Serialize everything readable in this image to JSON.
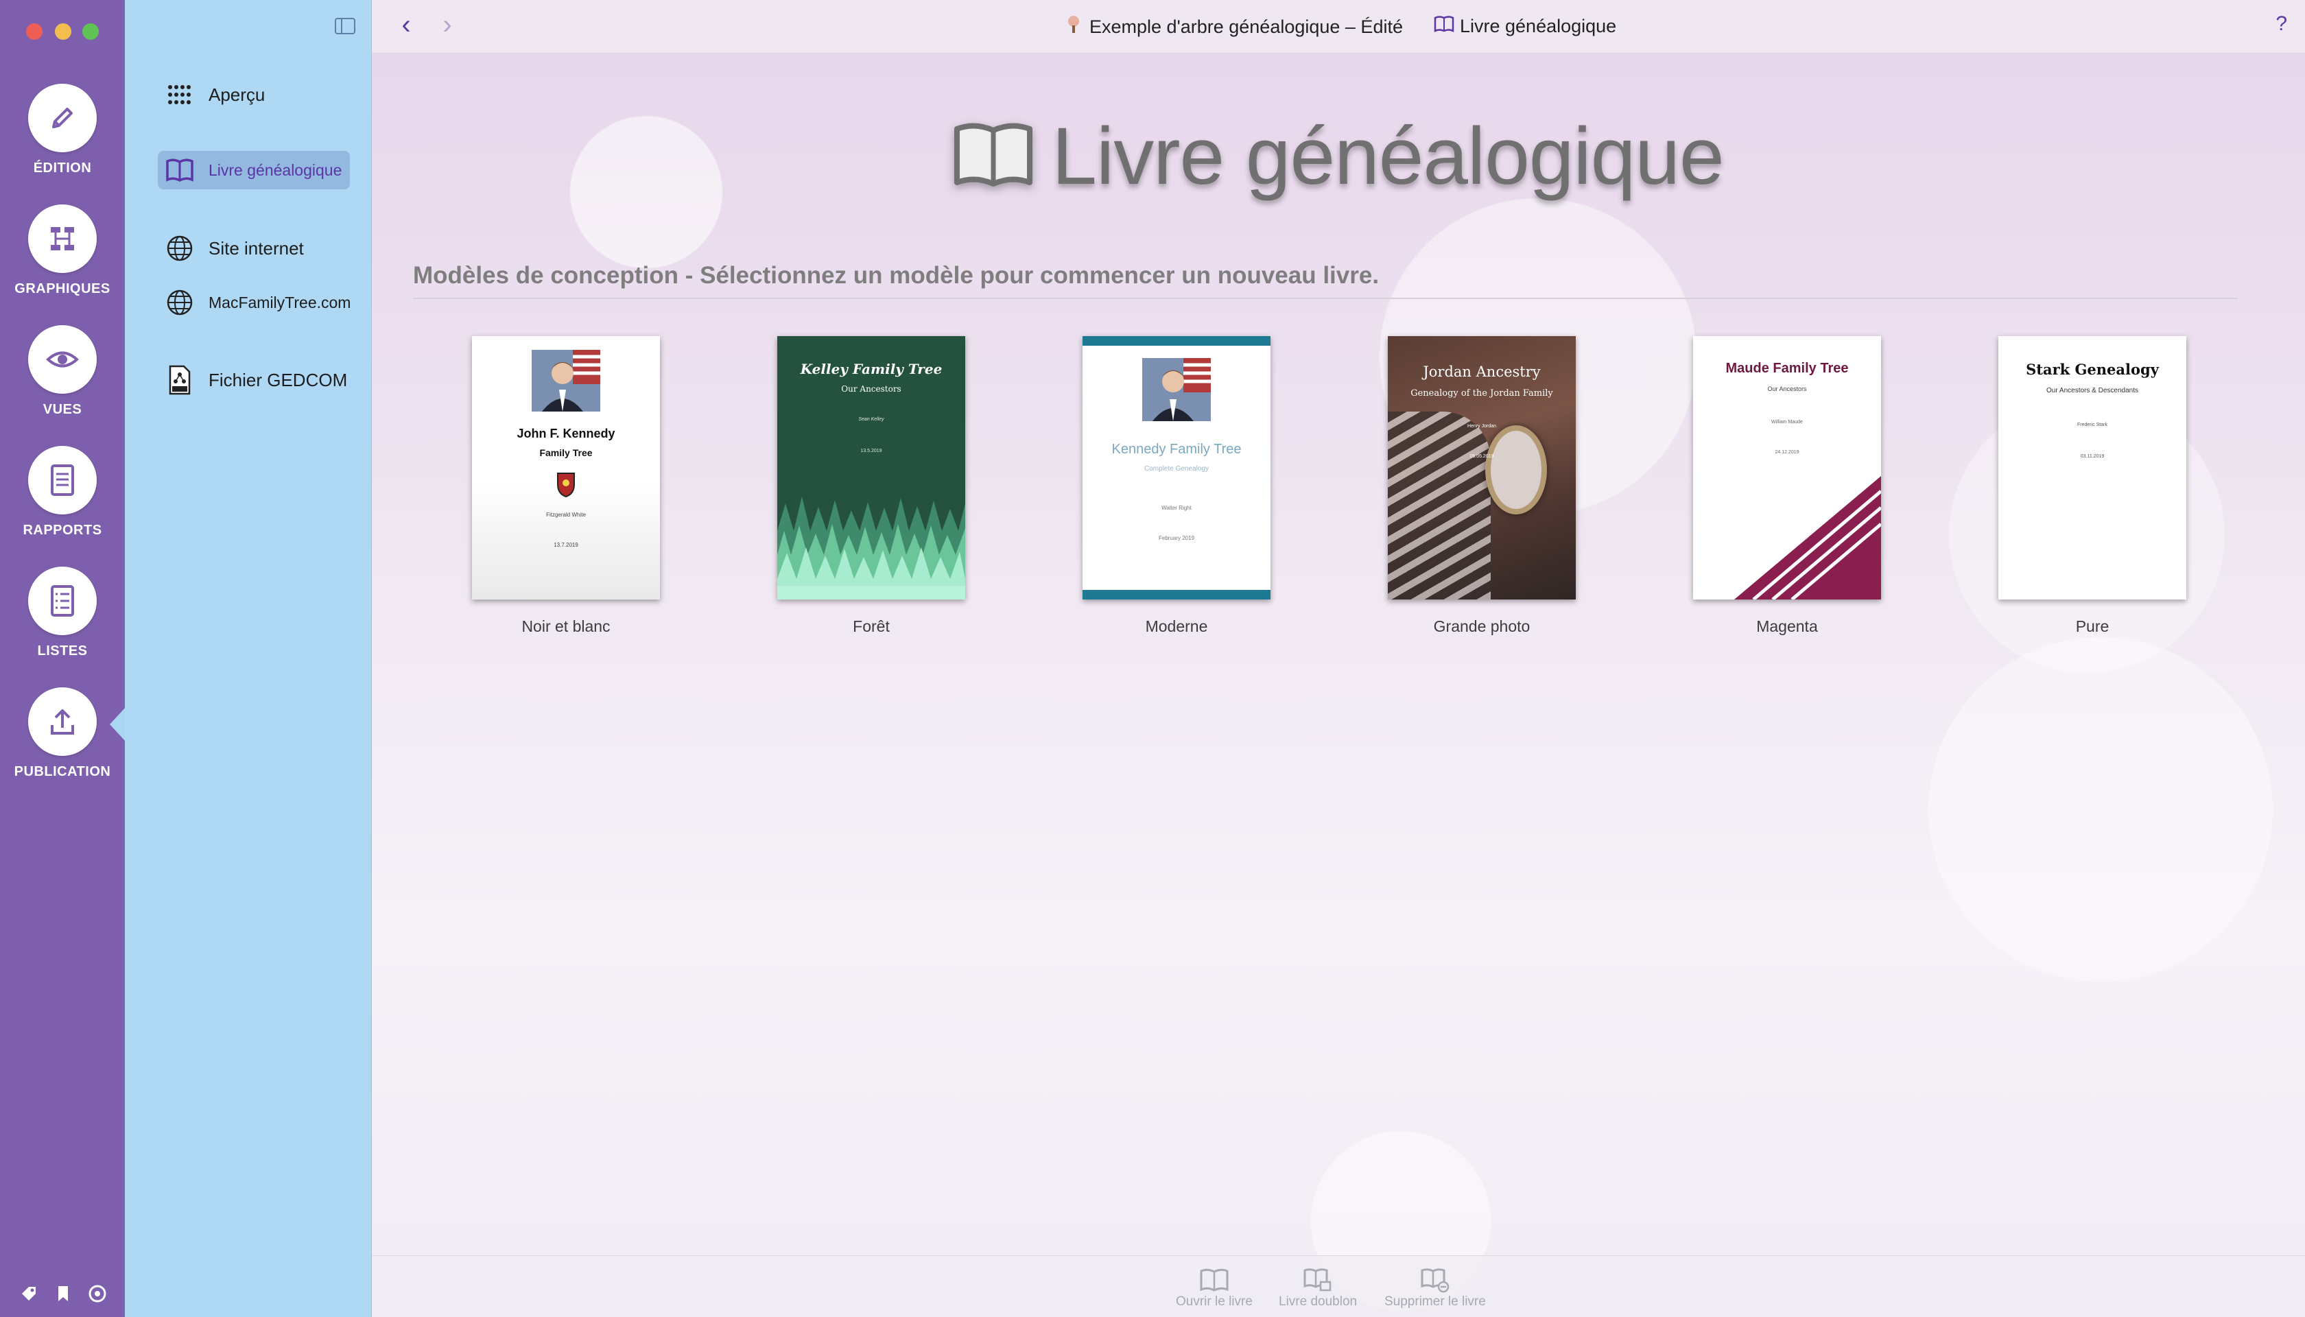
{
  "window": {
    "document_title": "Exemple d'arbre généalogique – Édité",
    "section_title": "Livre généalogique",
    "help_label": "?"
  },
  "rail": {
    "items": [
      {
        "label": "ÉDITION",
        "icon": "pencil-icon"
      },
      {
        "label": "GRAPHIQUES",
        "icon": "chart-icon"
      },
      {
        "label": "VUES",
        "icon": "eye-icon"
      },
      {
        "label": "RAPPORTS",
        "icon": "report-icon"
      },
      {
        "label": "LISTES",
        "icon": "list-icon"
      },
      {
        "label": "PUBLICATION",
        "icon": "upload-icon"
      }
    ],
    "active": "PUBLICATION",
    "bottom_icons": [
      "tag-icon",
      "bookmark-icon",
      "settings-icon"
    ]
  },
  "sidebar": {
    "items": [
      {
        "label": "Aperçu",
        "icon": "grid-icon"
      },
      {
        "label": "Livre généalogique",
        "icon": "book-icon",
        "selected": true
      },
      {
        "label": "Site internet",
        "icon": "globe-icon"
      },
      {
        "label": "MacFamilyTree.com",
        "icon": "globe-icon"
      },
      {
        "label": "Fichier GEDCOM",
        "icon": "gedcom-file-icon"
      }
    ]
  },
  "main": {
    "title": "Livre généalogique",
    "subheading": "Modèles de conception - Sélectionnez un modèle pour commencer un nouveau livre.",
    "templates": [
      {
        "name": "Noir et blanc",
        "cover": {
          "title": "John F. Kennedy",
          "subtitle": "Family Tree",
          "author": "Fitzgerald White",
          "date": "13.7.2019"
        }
      },
      {
        "name": "Forêt",
        "cover": {
          "title": "Kelley Family Tree",
          "subtitle": "Our Ancestors",
          "author": "Sean Kelley",
          "date": "13.5.2019"
        }
      },
      {
        "name": "Moderne",
        "cover": {
          "title": "Kennedy Family Tree",
          "subtitle": "Complete Genealogy",
          "author": "Walter Right",
          "date": "February 2019"
        }
      },
      {
        "name": "Grande photo",
        "cover": {
          "title": "Jordan Ancestry",
          "subtitle": "Genealogy of the Jordan Family",
          "author": "Henry Jordan",
          "date": "05.05.2019"
        }
      },
      {
        "name": "Magenta",
        "cover": {
          "title": "Maude Family Tree",
          "subtitle": "Our Ancestors",
          "author": "William Maude",
          "date": "24.12.2019"
        }
      },
      {
        "name": "Pure",
        "cover": {
          "title": "Stark Genealogy",
          "subtitle": "Our Ancestors & Descendants",
          "author": "Frederic Stark",
          "date": "03.11.2019"
        }
      }
    ]
  },
  "toolbar": {
    "open_label": "Ouvrir le livre",
    "duplicate_label": "Livre doublon",
    "delete_label": "Supprimer le livre"
  },
  "colors": {
    "rail": "#7d5fad",
    "sidebar": "#aed8f4",
    "accent": "#5a35a6"
  }
}
